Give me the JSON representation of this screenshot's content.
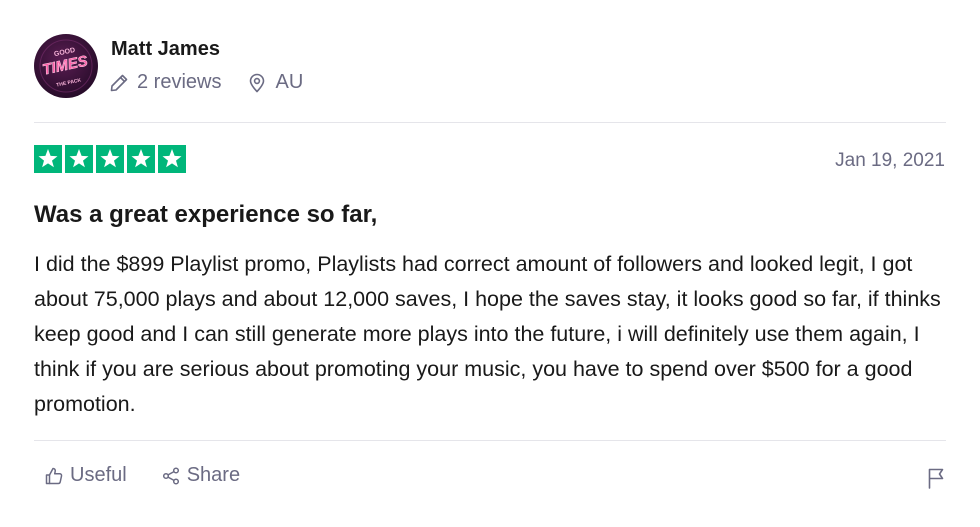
{
  "reviewer": {
    "name": "Matt James",
    "avatar_text": [
      "GOOD",
      "TIMES",
      "THE PACK"
    ],
    "reviews_count": "2 reviews",
    "country": "AU"
  },
  "review": {
    "rating": 5,
    "rating_max": 5,
    "date": "Jan 19, 2021",
    "title": "Was a great experience so far,",
    "body": "I did the $899 Playlist promo, Playlists had correct amount of followers and looked legit, I got about 75,000 plays and about 12,000 saves, I hope the saves stay, it looks good so far, if thinks keep good and I can still generate more plays into the future, i will definitely use them again, I think if you are serious about promoting your music, you have to spend over $500 for a good promotion."
  },
  "actions": {
    "useful_label": "Useful",
    "share_label": "Share"
  },
  "icons": {
    "reviews": "pencil-icon",
    "location": "location-pin-icon",
    "useful": "thumbs-up-icon",
    "share": "share-icon",
    "report": "flag-icon",
    "star": "star-icon"
  },
  "colors": {
    "star_fill": "#00b67a",
    "muted_text": "#6b6b83",
    "primary_text": "#191919",
    "divider": "#e5e5ea"
  }
}
